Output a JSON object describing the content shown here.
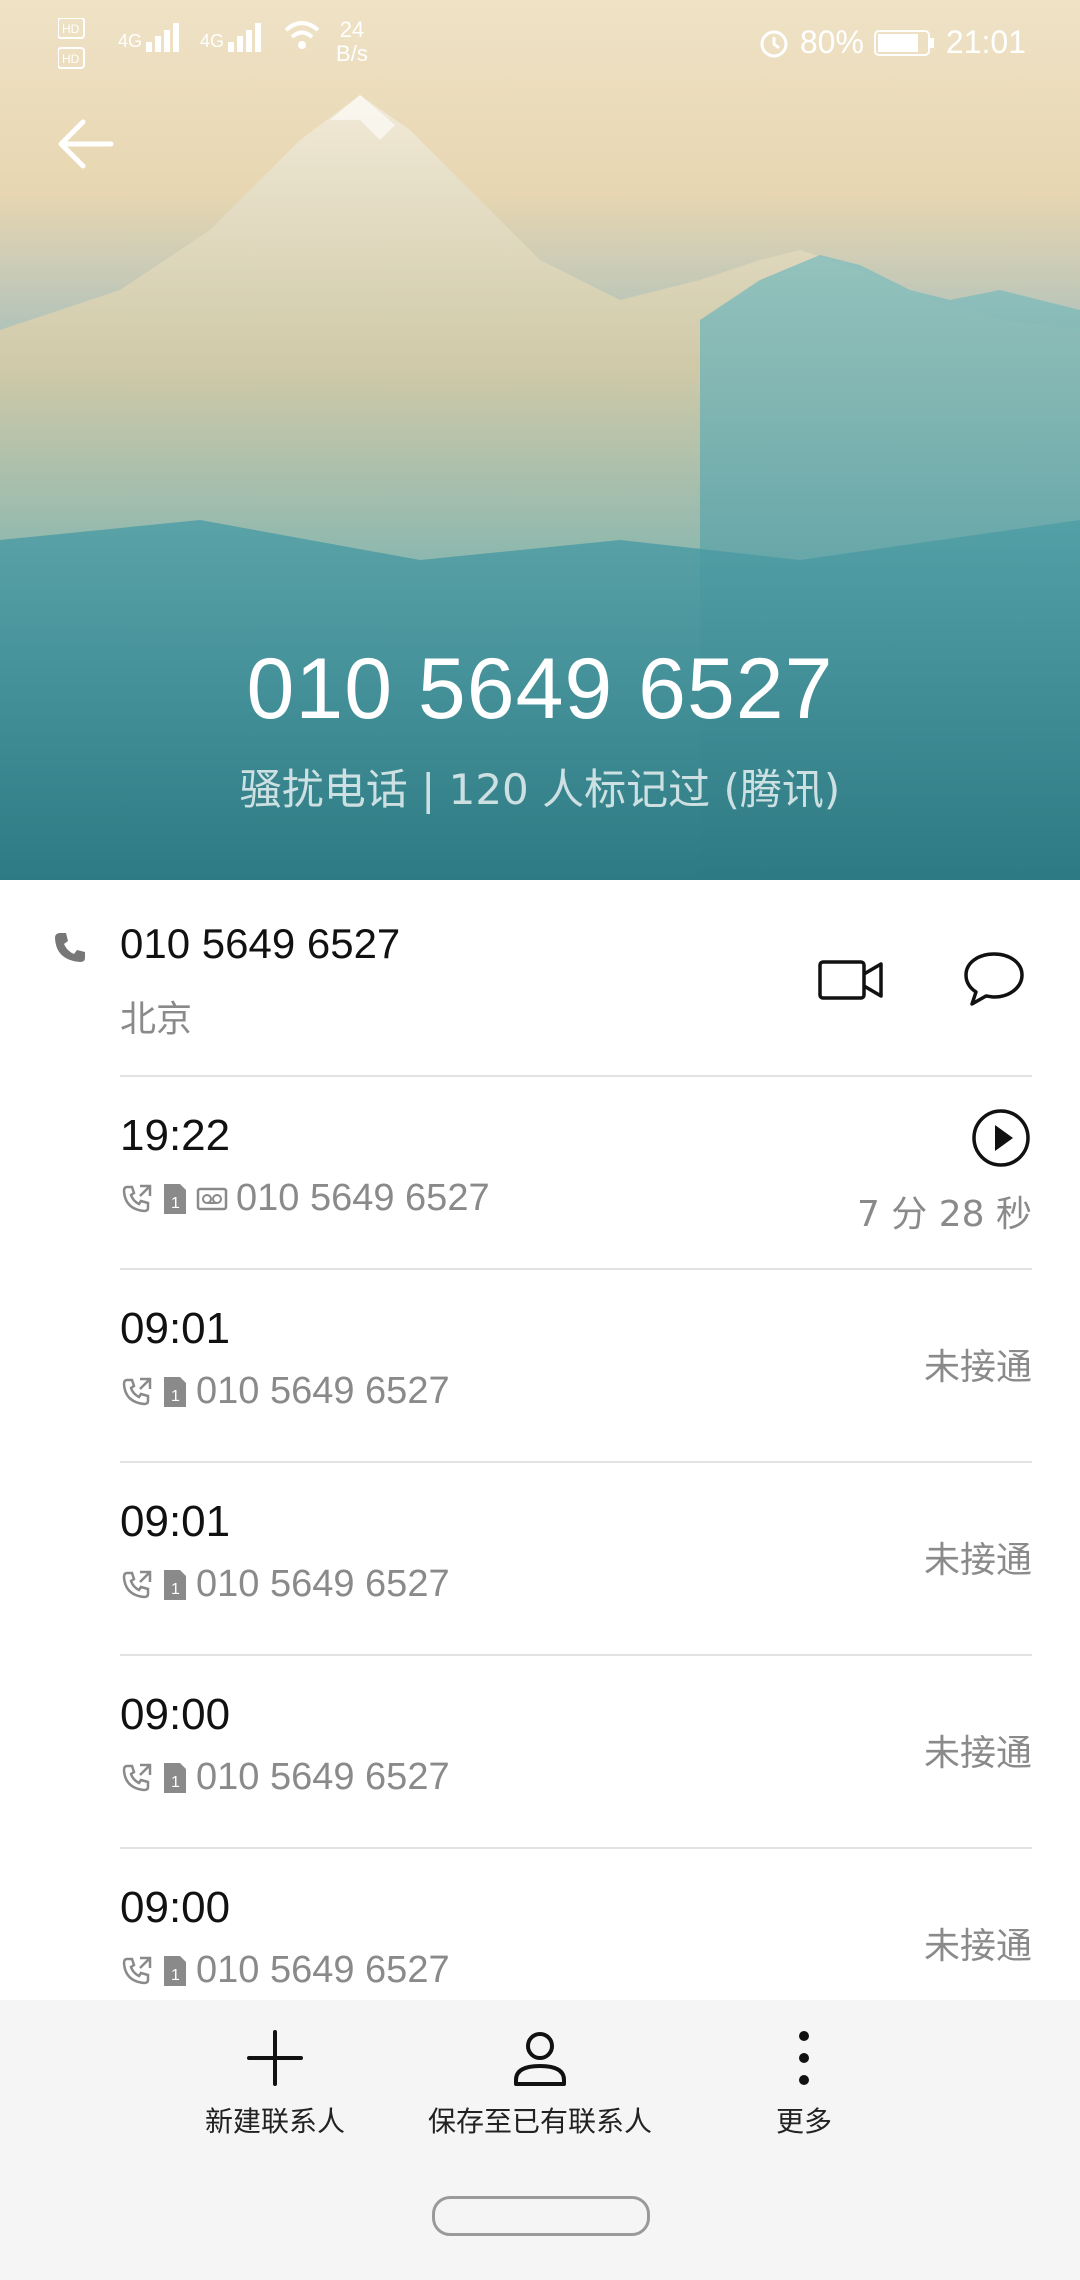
{
  "status_bar": {
    "speed_value": "24",
    "speed_unit": "B/s",
    "network_1": "4G",
    "network_2": "4G",
    "battery": "80%",
    "time": "21:01"
  },
  "header": {
    "number": "010 5649 6527",
    "subtitle": "骚扰电话 | 120 人标记过 (腾讯)"
  },
  "contact": {
    "number": "010 5649 6527",
    "location": "北京"
  },
  "calls": [
    {
      "time": "19:22",
      "number": "010 5649 6527",
      "duration": "7 分 28 秒",
      "has_recording": true
    },
    {
      "time": "09:01",
      "number": "010 5649 6527",
      "status": "未接通"
    },
    {
      "time": "09:01",
      "number": "010 5649 6527",
      "status": "未接通"
    },
    {
      "time": "09:00",
      "number": "010 5649 6527",
      "status": "未接通"
    },
    {
      "time": "09:00",
      "number": "010 5649 6527",
      "status": "未接通"
    }
  ],
  "bottom_bar": {
    "new_contact": "新建联系人",
    "save_existing": "保存至已有联系人",
    "more": "更多"
  },
  "colors": {
    "accent_text_gray": "#8a8a8a",
    "header_dark_teal": "#2f7d87"
  }
}
